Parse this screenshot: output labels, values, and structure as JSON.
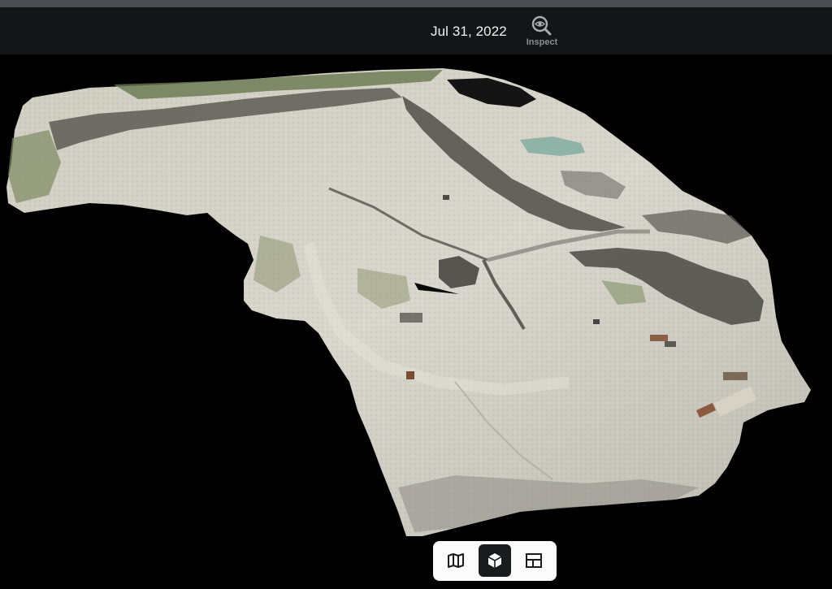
{
  "header": {
    "date": "Jul 31, 2022",
    "inspect_label": "Inspect",
    "inspect_icon": "magnifier-eye-icon"
  },
  "view_switcher": {
    "modes": [
      {
        "name": "map",
        "icon": "map-icon",
        "active": false
      },
      {
        "name": "3d",
        "icon": "cube-icon",
        "active": true
      },
      {
        "name": "layout",
        "icon": "layout-icon",
        "active": false
      }
    ]
  },
  "colors": {
    "header_bg": "#141516",
    "top_strip": "#4a4e53",
    "viewport_bg": "#000000",
    "switcher_bg": "#fbfbfb",
    "active_mode_bg": "#1a1b1d"
  }
}
